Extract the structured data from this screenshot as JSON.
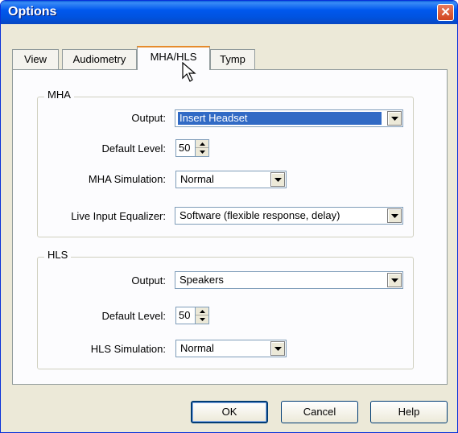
{
  "window": {
    "title": "Options"
  },
  "tabs": [
    {
      "label": "View"
    },
    {
      "label": "Audiometry"
    },
    {
      "label": "MHA/HLS",
      "active": true
    },
    {
      "label": "Tymp"
    }
  ],
  "mha": {
    "group_label": "MHA",
    "output": {
      "label": "Output:",
      "value": "Insert Headset"
    },
    "default_level": {
      "label": "Default Level:",
      "value": "50"
    },
    "simulation": {
      "label": "MHA Simulation:",
      "value": "Normal"
    },
    "equalizer": {
      "label": "Live Input Equalizer:",
      "value": "Software (flexible response, delay)"
    }
  },
  "hls": {
    "group_label": "HLS",
    "output": {
      "label": "Output:",
      "value": "Speakers"
    },
    "default_level": {
      "label": "Default Level:",
      "value": "50"
    },
    "simulation": {
      "label": "HLS Simulation:",
      "value": "Normal"
    }
  },
  "buttons": {
    "ok": "OK",
    "cancel": "Cancel",
    "help": "Help"
  },
  "colors": {
    "title_bar": "#0058ee",
    "selection": "#316ac5",
    "active_tab_accent": "#e68b2c"
  }
}
